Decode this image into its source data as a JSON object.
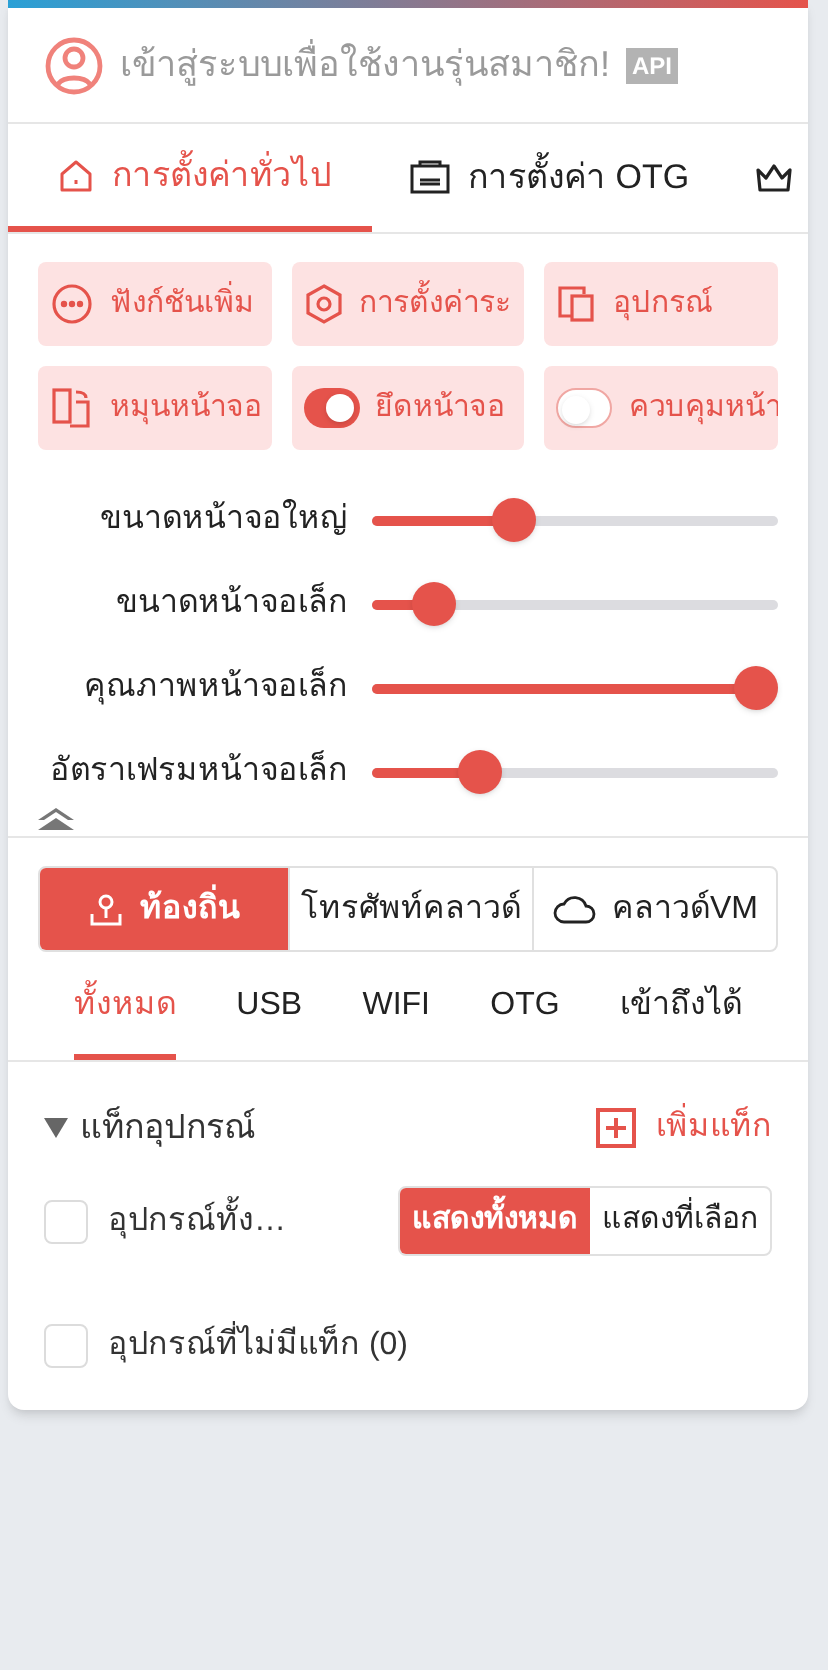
{
  "login": {
    "text": "เข้าสู่ระบบเพื่อใช้งานรุ่นสมาชิก!",
    "badge": "API"
  },
  "tabs": [
    {
      "label": "การตั้งค่าทั่วไป",
      "kind": "home",
      "selected": true
    },
    {
      "label": "การตั้งค่า OTG",
      "kind": "otg",
      "selected": false
    },
    {
      "kind": "crown",
      "selected": false
    }
  ],
  "actions": [
    {
      "label": "ฟังก์ชันเพิ่ม",
      "kind": "more"
    },
    {
      "label": "การตั้งค่าระ",
      "kind": "settings"
    },
    {
      "label": "อุปกรณ์",
      "kind": "devices"
    },
    {
      "label": "หมุนหน้าจอ",
      "kind": "rotate"
    },
    {
      "label": "ยึดหน้าจอ",
      "kind": "toggle",
      "on": true
    },
    {
      "label": "ควบคุมหน้า",
      "kind": "toggle",
      "on": false
    }
  ],
  "sliders": [
    {
      "label": "ขนาดหน้าจอใหญ่",
      "level": 0.33
    },
    {
      "label": "ขนาดหน้าจอเล็ก",
      "level": 0.11
    },
    {
      "label": "คุณภาพหน้าจอเล็ก",
      "level": 1
    },
    {
      "label": "อัตราเฟรมหน้าจอเล็ก",
      "level": 0.24
    }
  ],
  "sources": [
    {
      "label": "ท้องถิ่น",
      "kind": "local",
      "selected": true
    },
    {
      "label": "โทรศัพท์คลาวด์",
      "kind": "phone",
      "selected": false
    },
    {
      "label": "คลาวด์VM",
      "kind": "cloud",
      "selected": false
    }
  ],
  "filters": [
    {
      "label": "ทั้งหมด",
      "selected": true
    },
    {
      "label": "USB",
      "selected": false
    },
    {
      "label": "WIFI",
      "selected": false
    },
    {
      "label": "OTG",
      "selected": false
    },
    {
      "label": "เข้าถึงได้",
      "selected": false
    }
  ],
  "tags": {
    "title": "แท็กอุปกรณ์",
    "expanded": true,
    "add": "เพิ่มแท็ก",
    "rows": [
      {
        "label": "อุปกรณ์ทั้ง…",
        "checked": false,
        "modes": [
          {
            "label": "แสดงทั้งหมด",
            "selected": true
          },
          {
            "label": "แสดงที่เลือก",
            "selected": false
          }
        ]
      },
      {
        "label": "อุปกรณ์ที่ไม่มีแท็ก (0)",
        "checked": false
      }
    ]
  }
}
